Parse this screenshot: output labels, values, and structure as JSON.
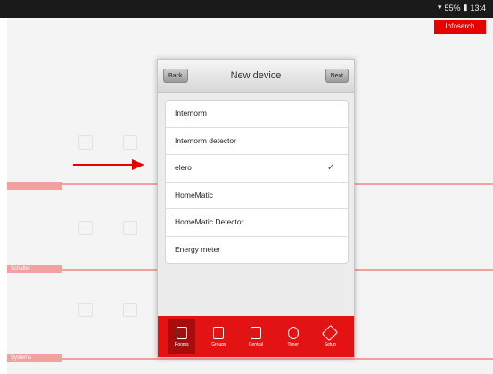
{
  "status_bar": {
    "time": "13:4",
    "battery": "55%"
  },
  "background": {
    "top_right_button": "Infoserch",
    "section_labels": [
      "",
      "Schalter",
      "Systems"
    ]
  },
  "dialog": {
    "back_label": "Back",
    "title": "New device",
    "next_label": "Next",
    "items": [
      {
        "label": "Intemorm",
        "selected": false
      },
      {
        "label": "Intemorm detector",
        "selected": false
      },
      {
        "label": "elero",
        "selected": true
      },
      {
        "label": "HomeMatic",
        "selected": false
      },
      {
        "label": "HomeMatic Detector",
        "selected": false
      },
      {
        "label": "Energy meter",
        "selected": false
      }
    ],
    "check_glyph": "✓"
  },
  "tabbar": {
    "tabs": [
      {
        "label": "Rooms",
        "icon": "rooms-icon",
        "active": true
      },
      {
        "label": "Groups",
        "icon": "groups-icon",
        "active": false
      },
      {
        "label": "Central",
        "icon": "central-icon",
        "active": false
      },
      {
        "label": "Timer",
        "icon": "timer-icon",
        "active": false
      },
      {
        "label": "Setup",
        "icon": "setup-icon",
        "active": false
      }
    ]
  },
  "colors": {
    "accent": "#e31313",
    "arrow": "#e60000"
  }
}
